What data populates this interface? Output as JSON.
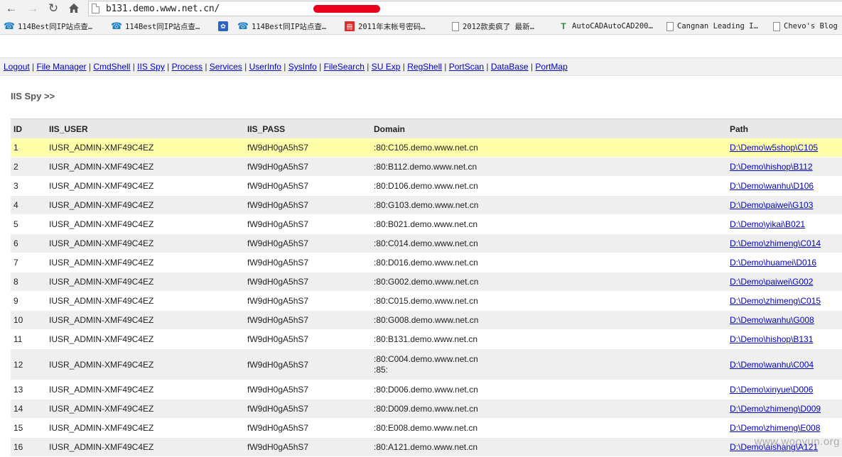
{
  "browser": {
    "url": "b131.demo.www.net.cn/",
    "bookmarks": [
      {
        "icon": "phone-icon",
        "label": "114Best同IP站点查…"
      },
      {
        "icon": "phone-icon",
        "label": "114Best同IP站点查…"
      },
      {
        "icon": "paw-icon",
        "label": ""
      },
      {
        "icon": "phone-icon",
        "label": "114Best同IP站点查…"
      },
      {
        "icon": "calendar-icon",
        "label": "2011年末帐号密码…"
      },
      {
        "icon": "document-icon",
        "label": "2012款卖疯了 最新…"
      },
      {
        "icon": "autocad-icon",
        "label": "AutoCADAutoCAD200…"
      },
      {
        "icon": "document-icon",
        "label": "Cangnan Leading I…"
      },
      {
        "icon": "document-icon",
        "label": "Chevo's Blog"
      }
    ]
  },
  "menu": [
    "Logout",
    "File Manager",
    "CmdShell",
    "IIS Spy",
    "Process",
    "Services",
    "UserInfo",
    "SysInfo",
    "FileSearch",
    "SU Exp",
    "RegShell",
    "PortScan",
    "DataBase",
    "PortMap"
  ],
  "section_title": "IIS Spy >>",
  "table": {
    "headers": [
      "ID",
      "IIS_USER",
      "IIS_PASS",
      "Domain",
      "Path"
    ],
    "rows": [
      {
        "id": "1",
        "user": "IUSR_ADMIN-XMF49C4EZ",
        "pass": "fW9dH0gA5hS7",
        "domain": ":80:C105.demo.www.net.cn",
        "domain2": "",
        "path": "D:\\Demo\\w5shop\\C105"
      },
      {
        "id": "2",
        "user": "IUSR_ADMIN-XMF49C4EZ",
        "pass": "fW9dH0gA5hS7",
        "domain": ":80:B112.demo.www.net.cn",
        "domain2": "",
        "path": "D:\\Demo\\hishop\\B112"
      },
      {
        "id": "3",
        "user": "IUSR_ADMIN-XMF49C4EZ",
        "pass": "fW9dH0gA5hS7",
        "domain": ":80:D106.demo.www.net.cn",
        "domain2": "",
        "path": "D:\\Demo\\wanhu\\D106"
      },
      {
        "id": "4",
        "user": "IUSR_ADMIN-XMF49C4EZ",
        "pass": "fW9dH0gA5hS7",
        "domain": ":80:G103.demo.www.net.cn",
        "domain2": "",
        "path": "D:\\Demo\\paiwei\\G103"
      },
      {
        "id": "5",
        "user": "IUSR_ADMIN-XMF49C4EZ",
        "pass": "fW9dH0gA5hS7",
        "domain": ":80:B021.demo.www.net.cn",
        "domain2": "",
        "path": "D:\\Demo\\yikai\\B021"
      },
      {
        "id": "6",
        "user": "IUSR_ADMIN-XMF49C4EZ",
        "pass": "fW9dH0gA5hS7",
        "domain": ":80:C014.demo.www.net.cn",
        "domain2": "",
        "path": "D:\\Demo\\zhimeng\\C014"
      },
      {
        "id": "7",
        "user": "IUSR_ADMIN-XMF49C4EZ",
        "pass": "fW9dH0gA5hS7",
        "domain": ":80:D016.demo.www.net.cn",
        "domain2": "",
        "path": "D:\\Demo\\huamei\\D016"
      },
      {
        "id": "8",
        "user": "IUSR_ADMIN-XMF49C4EZ",
        "pass": "fW9dH0gA5hS7",
        "domain": ":80:G002.demo.www.net.cn",
        "domain2": "",
        "path": "D:\\Demo\\paiwei\\G002"
      },
      {
        "id": "9",
        "user": "IUSR_ADMIN-XMF49C4EZ",
        "pass": "fW9dH0gA5hS7",
        "domain": ":80:C015.demo.www.net.cn",
        "domain2": "",
        "path": "D:\\Demo\\zhimeng\\C015"
      },
      {
        "id": "10",
        "user": "IUSR_ADMIN-XMF49C4EZ",
        "pass": "fW9dH0gA5hS7",
        "domain": ":80:G008.demo.www.net.cn",
        "domain2": "",
        "path": "D:\\Demo\\wanhu\\G008"
      },
      {
        "id": "11",
        "user": "IUSR_ADMIN-XMF49C4EZ",
        "pass": "fW9dH0gA5hS7",
        "domain": ":80:B131.demo.www.net.cn",
        "domain2": "",
        "path": "D:\\Demo\\hishop\\B131"
      },
      {
        "id": "12",
        "user": "IUSR_ADMIN-XMF49C4EZ",
        "pass": "fW9dH0gA5hS7",
        "domain": ":80:C004.demo.www.net.cn",
        "domain2": ":85:",
        "path": "D:\\Demo\\wanhu\\C004"
      },
      {
        "id": "13",
        "user": "IUSR_ADMIN-XMF49C4EZ",
        "pass": "fW9dH0gA5hS7",
        "domain": ":80:D006.demo.www.net.cn",
        "domain2": "",
        "path": "D:\\Demo\\xinyue\\D006"
      },
      {
        "id": "14",
        "user": "IUSR_ADMIN-XMF49C4EZ",
        "pass": "fW9dH0gA5hS7",
        "domain": ":80:D009.demo.www.net.cn",
        "domain2": "",
        "path": "D:\\Demo\\zhimeng\\D009"
      },
      {
        "id": "15",
        "user": "IUSR_ADMIN-XMF49C4EZ",
        "pass": "fW9dH0gA5hS7",
        "domain": ":80:E008.demo.www.net.cn",
        "domain2": "",
        "path": "D:\\Demo\\zhimeng\\E008"
      },
      {
        "id": "16",
        "user": "IUSR_ADMIN-XMF49C4EZ",
        "pass": "fW9dH0gA5hS7",
        "domain": ":80:A121.demo.www.net.cn",
        "domain2": "",
        "path": "D:\\Demo\\aishang\\A121"
      }
    ]
  },
  "watermark": "www.wooyun.org",
  "colors": {
    "highlight_row": "#ffffaa",
    "link": "#0000cc",
    "redaction": "#e8001c"
  }
}
